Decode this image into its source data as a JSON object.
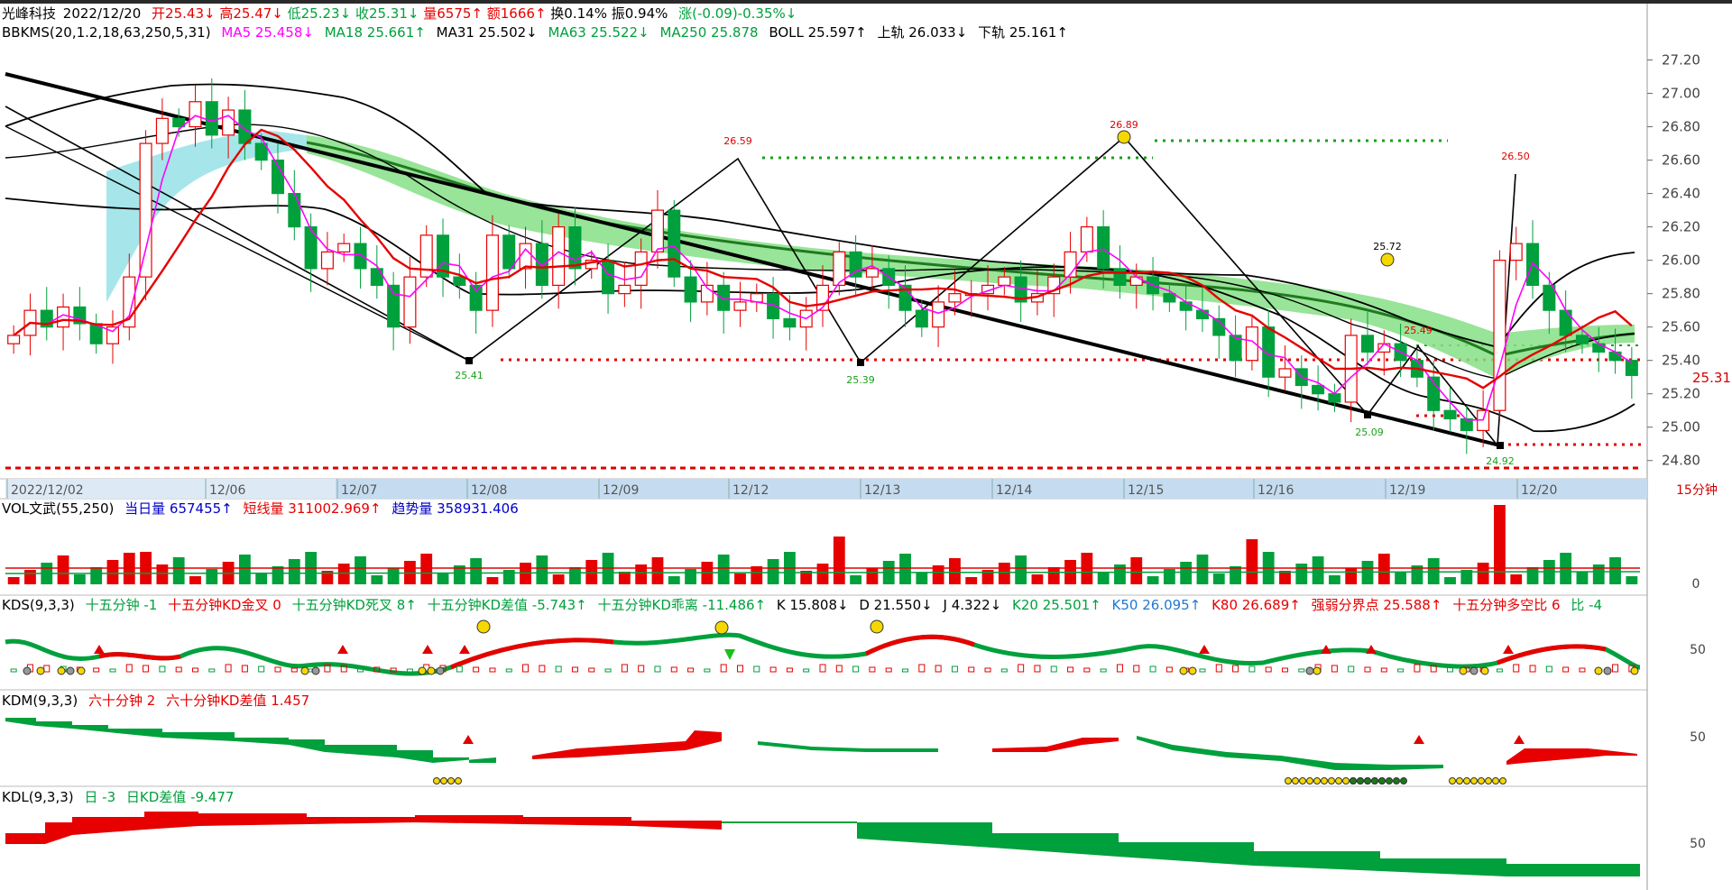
{
  "colors": {
    "up": "#e60000",
    "down": "#00a03c",
    "band_fill": "#86df86",
    "cyan_fill": "#a6e6ea",
    "magenta": "#ff00ff",
    "blue": "#0000c8",
    "dark_green": "#207a20",
    "dashed_red": "#e00000",
    "dashed_green": "#19a019"
  },
  "header_main": {
    "name": "光峰科技",
    "date": "2022/12/20",
    "open": "开25.43↓",
    "high": "高25.47↓",
    "low": "低25.23↓",
    "close": "收25.31↓",
    "volume": "量6575↑",
    "amount": "额1666↑",
    "turnover": "换0.14%",
    "amplitude": "振0.94%",
    "change": "涨(-0.09)-0.35%↓"
  },
  "header_bbkms": {
    "name": "BBKMS(20,1.2,18,63,250,5,31)",
    "ma5": "MA5 25.458↓",
    "ma18": "MA18 25.661↑",
    "ma31": "MA31 25.502↓",
    "ma63": "MA63 25.522↓",
    "ma250": "MA250 25.878",
    "boll": "BOLL 25.597↑",
    "upper": "上轨 26.033↓",
    "lower": "下轨 25.161↑"
  },
  "header_vol": {
    "name": "VOL文武(55,250)",
    "day": "当日量 657455↑",
    "short": "短线量 311002.969↑",
    "trend": "趋势量 358931.406"
  },
  "header_kds": {
    "name": "KDS(9,3,3)",
    "a": "十五分钟 -1",
    "b": "十五分钟KD金叉 0",
    "c": "十五分钟KD死叉 8↑",
    "d": "十五分钟KD差值 -5.743↑",
    "e": "十五分钟KD乖离 -11.486↑",
    "k": "K 15.808↓",
    "dv": "D 21.550↓",
    "j": "J 4.322↓",
    "k20": "K20 25.501↑",
    "k50": "K50 26.095↑",
    "k80": "K80 26.689↑",
    "qr": "强弱分界点 25.588↑",
    "dk": "十五分钟多空比 6",
    "bi": "比 -4"
  },
  "header_kdm": {
    "name": "KDM(9,3,3)",
    "a": "六十分钟 2",
    "b": "六十分钟KD差值 1.457"
  },
  "header_kdl": {
    "name": "KDL(9,3,3)",
    "a": "日 -3",
    "b": "日KD差值 -9.477"
  },
  "x_axis_labels": [
    "2022/12/02",
    "12/06",
    "12/07",
    "12/08",
    "12/09",
    "12/12",
    "12/13",
    "12/14",
    "12/15",
    "12/16",
    "12/19",
    "12/20"
  ],
  "price_axis": [
    "27.20",
    "27.00",
    "26.80",
    "26.60",
    "26.40",
    "26.20",
    "26.00",
    "25.80",
    "25.60",
    "25.40",
    "25.20",
    "25.00",
    "24.80"
  ],
  "last_price": "25.31",
  "period": "15分钟",
  "vol_axis": "0",
  "kd_axis": "50",
  "annotations": [
    {
      "text": "26.59",
      "color": "red"
    },
    {
      "text": "25.41",
      "color": "green"
    },
    {
      "text": "25.39",
      "color": "green"
    },
    {
      "text": "26.89",
      "color": "red"
    },
    {
      "text": "25.72",
      "color": "black"
    },
    {
      "text": "25.09",
      "color": "green"
    },
    {
      "text": "25.49",
      "color": "red"
    },
    {
      "text": "26.50",
      "color": "red"
    },
    {
      "text": "24.92",
      "color": "green"
    }
  ],
  "chart_data": {
    "type": "candlestick",
    "symbol": "光峰科技",
    "period": "15分钟",
    "ylim": [
      24.75,
      27.3
    ],
    "days": [
      "2022/12/02",
      "12/06",
      "12/07",
      "12/08",
      "12/09",
      "12/12",
      "12/13",
      "12/14",
      "12/15",
      "12/16",
      "12/19",
      "12/20"
    ],
    "closes": [
      25.55,
      25.7,
      25.6,
      25.72,
      25.62,
      25.5,
      25.6,
      25.9,
      26.7,
      26.85,
      26.8,
      26.95,
      26.75,
      26.9,
      26.7,
      26.6,
      26.4,
      26.2,
      25.95,
      26.05,
      26.1,
      25.95,
      25.85,
      25.6,
      25.9,
      26.15,
      25.9,
      25.85,
      25.7,
      26.15,
      25.95,
      26.1,
      25.85,
      26.2,
      25.95,
      26.0,
      25.8,
      25.85,
      26.05,
      26.3,
      25.9,
      25.75,
      25.85,
      25.7,
      25.75,
      25.8,
      25.65,
      25.6,
      25.7,
      25.85,
      26.05,
      25.9,
      25.95,
      25.85,
      25.7,
      25.6,
      25.75,
      25.8,
      25.8,
      25.85,
      25.9,
      25.75,
      25.8,
      25.9,
      26.05,
      26.2,
      25.95,
      25.85,
      25.9,
      25.8,
      25.75,
      25.7,
      25.65,
      25.55,
      25.4,
      25.6,
      25.3,
      25.35,
      25.25,
      25.2,
      25.15,
      25.55,
      25.45,
      25.5,
      25.4,
      25.3,
      25.1,
      25.05,
      24.98,
      25.1,
      26.0,
      26.1,
      25.85,
      25.7,
      25.55,
      25.5,
      25.45,
      25.4,
      25.31
    ],
    "vol_series": [
      {
        "name": "短线量",
        "value": 311002.969
      },
      {
        "name": "趋势量",
        "value": 358931.406
      }
    ],
    "extremes": [
      {
        "label": "26.59"
      },
      {
        "label": "25.41"
      },
      {
        "label": "25.39"
      },
      {
        "label": "26.89"
      },
      {
        "label": "25.72"
      },
      {
        "label": "25.09"
      },
      {
        "label": "26.50"
      },
      {
        "label": "24.92"
      }
    ]
  }
}
